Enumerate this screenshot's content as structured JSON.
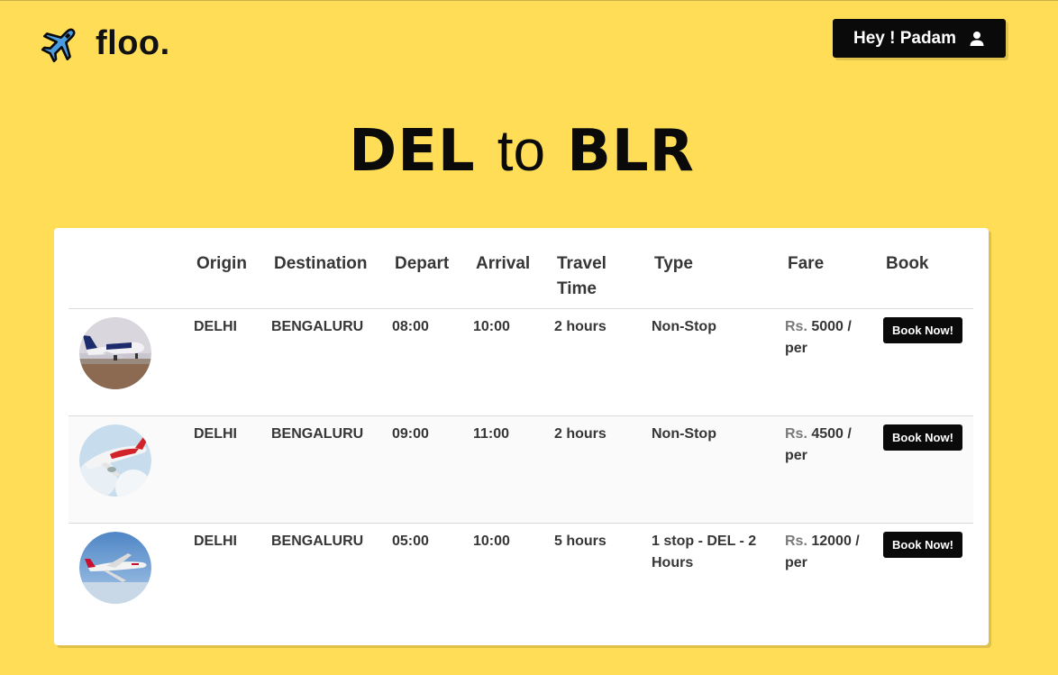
{
  "brand": {
    "name": "floo.",
    "logo_icon": "airplane-icon"
  },
  "user": {
    "greeting": "Hey ! Padam",
    "icon": "user-icon"
  },
  "route": {
    "origin": "DEL",
    "connector": "to",
    "destination": "BLR"
  },
  "table": {
    "headers": {
      "origin": "Origin",
      "destination": "Destination",
      "depart": "Depart",
      "arrival": "Arrival",
      "travel_time": "Travel Time",
      "type": "Type",
      "fare": "Fare",
      "book": "Book"
    },
    "rows": [
      {
        "image": "indigo-plane-photo",
        "origin": "DELHI",
        "destination": "BENGALURU",
        "depart": "08:00",
        "arrival": "10:00",
        "travel_time": "2 hours",
        "type": "Non-Stop",
        "fare_prefix": "Rs.",
        "fare_value": "5000 / per",
        "book_label": "Book Now!"
      },
      {
        "image": "airasia-plane-photo",
        "origin": "DELHI",
        "destination": "BENGALURU",
        "depart": "09:00",
        "arrival": "11:00",
        "travel_time": "2 hours",
        "type": "Non-Stop",
        "fare_prefix": "Rs.",
        "fare_value": "4500 / per",
        "book_label": "Book Now!"
      },
      {
        "image": "emirates-plane-photo",
        "origin": "DELHI",
        "destination": "BENGALURU",
        "depart": "05:00",
        "arrival": "10:00",
        "travel_time": "5 hours",
        "type": "1 stop - DEL - 2 Hours",
        "fare_prefix": "Rs.",
        "fare_value": "12000 / per",
        "book_label": "Book Now!"
      }
    ]
  },
  "colors": {
    "page_background": "#ffdd57",
    "button_background": "#0a0a0a",
    "card_background": "#ffffff",
    "text": "#363636"
  }
}
